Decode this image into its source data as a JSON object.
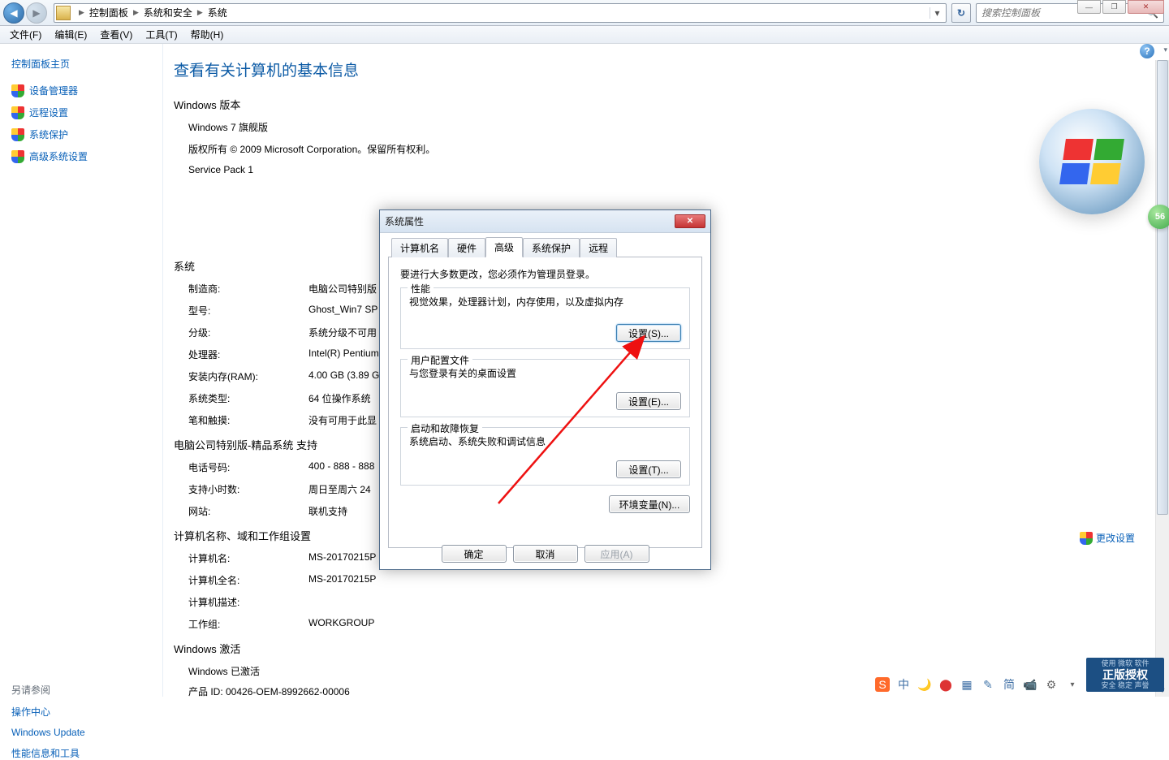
{
  "window_controls": {
    "min": "—",
    "max": "❐",
    "close": "✕"
  },
  "breadcrumb": {
    "items": [
      "控制面板",
      "系统和安全",
      "系统"
    ],
    "dropdown_icon": "▾"
  },
  "refresh_icon": "↻",
  "search": {
    "placeholder": "搜索控制面板",
    "icon": "🔍"
  },
  "menubar": {
    "file": "文件(F)",
    "edit": "编辑(E)",
    "view": "查看(V)",
    "tools": "工具(T)",
    "help": "帮助(H)"
  },
  "sidebar": {
    "home": "控制面板主页",
    "items": [
      "设备管理器",
      "远程设置",
      "系统保护",
      "高级系统设置"
    ],
    "see_also_title": "另请参阅",
    "see_also_links": [
      "操作中心",
      "Windows Update",
      "性能信息和工具"
    ]
  },
  "main": {
    "title": "查看有关计算机的基本信息",
    "help_icon": "?",
    "chevron": "▾",
    "edition_section": "Windows 版本",
    "edition": "Windows 7 旗舰版",
    "copyright": "版权所有 © 2009 Microsoft Corporation。保留所有权利。",
    "sp": "Service Pack 1",
    "system_section": "系统",
    "rows": {
      "manufacturer_k": "制造商:",
      "manufacturer_v": "电脑公司特别版",
      "model_k": "型号:",
      "model_v": "Ghost_Win7 SP",
      "rating_k": "分级:",
      "rating_v": "系统分级不可用",
      "processor_k": "处理器:",
      "processor_v": "Intel(R) Pentium",
      "ram_k": "安装内存(RAM):",
      "ram_v": "4.00 GB (3.89 G",
      "type_k": "系统类型:",
      "type_v": "64 位操作系统",
      "pen_k": "笔和触摸:",
      "pen_v": "没有可用于此显"
    },
    "support_section": "电脑公司特别版-精品系统 支持",
    "support_rows": {
      "phone_k": "电话号码:",
      "phone_v": "400 - 888 - 888",
      "hours_k": "支持小时数:",
      "hours_v": "周日至周六 24",
      "site_k": "网站:",
      "site_v": "联机支持"
    },
    "name_section": "计算机名称、域和工作组设置",
    "name_rows": {
      "name_k": "计算机名:",
      "name_v": "MS-20170215P",
      "full_k": "计算机全名:",
      "full_v": "MS-20170215P",
      "desc_k": "计算机描述:",
      "desc_v": "",
      "wg_k": "工作组:",
      "wg_v": "WORKGROUP"
    },
    "activation_section": "Windows 激活",
    "activation_status": "Windows 已激活",
    "product_id": "产品 ID: 00426-OEM-8992662-00006",
    "change_settings": "更改设置"
  },
  "dialog": {
    "title": "系统属性",
    "close": "✕",
    "tabs": [
      "计算机名",
      "硬件",
      "高级",
      "系统保护",
      "远程"
    ],
    "active_tab_index": 2,
    "admin_note": "要进行大多数更改，您必须作为管理员登录。",
    "perf_legend": "性能",
    "perf_desc": "视觉效果，处理器计划，内存使用，以及虚拟内存",
    "perf_btn": "设置(S)...",
    "profile_legend": "用户配置文件",
    "profile_desc": "与您登录有关的桌面设置",
    "profile_btn": "设置(E)...",
    "startup_legend": "启动和故障恢复",
    "startup_desc": "系统启动、系统失败和调试信息",
    "startup_btn": "设置(T)...",
    "env_btn": "环境变量(N)...",
    "ok": "确定",
    "cancel": "取消",
    "apply": "应用(A)"
  },
  "badge56": "56",
  "tray": {
    "items": [
      "中",
      "🌙",
      "⬤",
      "▦",
      "✎",
      "简",
      "📹",
      "⚙",
      "▾"
    ]
  },
  "watermark": {
    "top": "使用 微软 软件",
    "mid": "正版授权",
    "bottom": "安全 稳定 声誉"
  }
}
